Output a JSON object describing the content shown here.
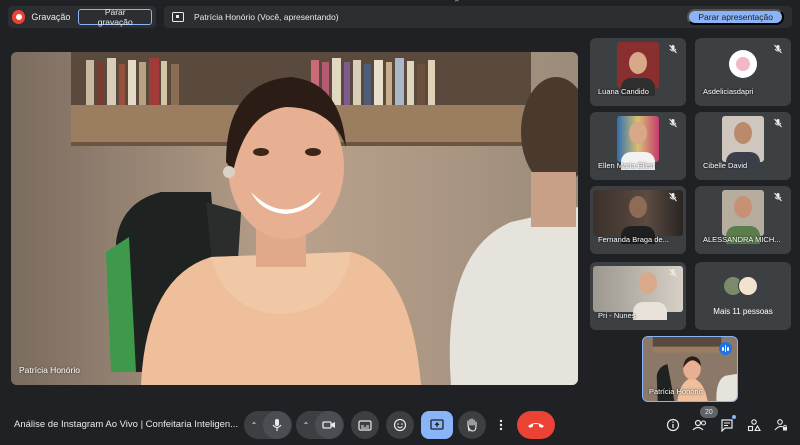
{
  "recording": {
    "label": "Gravação",
    "stop_label": "Parar gravação"
  },
  "presentation": {
    "text": "Patrícia Honório (Você, apresentando)",
    "stop_label": "Parar apresentação"
  },
  "main_video": {
    "name": "Patrícia Honório"
  },
  "participants": [
    {
      "name": "Luana Candido"
    },
    {
      "name": "Asdeliciasdapri"
    },
    {
      "name": "Ellen Maria Ellen"
    },
    {
      "name": "Cibelle David"
    },
    {
      "name": "Fernanda Braga de..."
    },
    {
      "name": "ALESSANDRA MICH..."
    },
    {
      "name": "Pri - Nunes"
    }
  ],
  "more_people": {
    "label": "Mais 11 pessoas"
  },
  "self_view": {
    "name": "Patrícia Honório"
  },
  "bottom_bar": {
    "meeting_title": "Análise de Instagram Ao Vivo | Confeitaria Inteligen...",
    "participant_count": "20"
  },
  "colors": {
    "background": "#202124",
    "surface": "#3c4043",
    "accent": "#8ab4f8",
    "danger": "#ea4335"
  }
}
